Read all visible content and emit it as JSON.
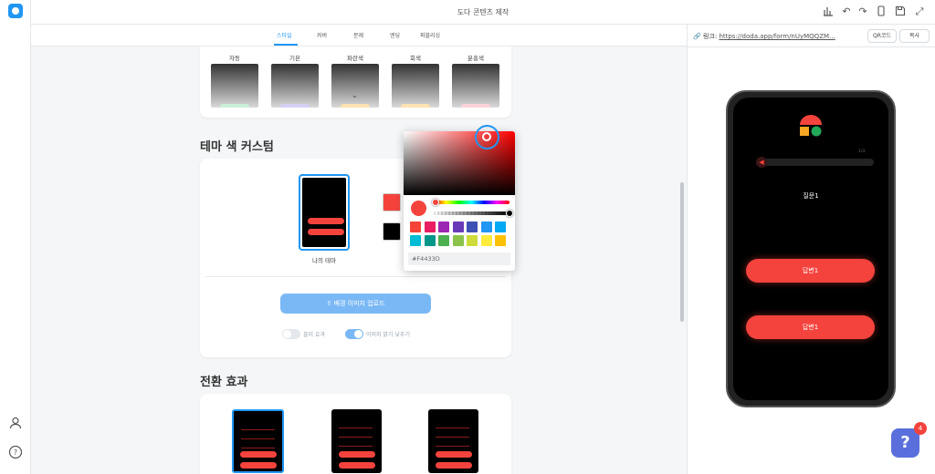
{
  "app": {
    "title": "도다 콘텐츠 제작"
  },
  "tabs": [
    {
      "label": "스타일",
      "active": true
    },
    {
      "label": "커버"
    },
    {
      "label": "문제"
    },
    {
      "label": "엔딩"
    },
    {
      "label": "퍼블리싱"
    }
  ],
  "style_presets": [
    {
      "label": "자동",
      "chip_color": "#c8f0d8"
    },
    {
      "label": "기본",
      "chip_color": "#d6d0f5"
    },
    {
      "label": "파란색",
      "chip_color": "#fde3b0"
    },
    {
      "label": "회색",
      "chip_color": "#fde3b0"
    },
    {
      "label": "분홍색",
      "chip_color": "#fbd3d8"
    }
  ],
  "theme_custom": {
    "title": "테마 색 커스텀",
    "my_theme_label": "나의 테마",
    "primary_color": "#f4433d",
    "background_color": "#000000",
    "upload_label": "배경 이미지 업로드",
    "toggles": [
      {
        "label": "블러 효과",
        "on": false
      },
      {
        "label": "이미지 밝기 낮추기",
        "on": true
      }
    ]
  },
  "color_picker": {
    "hex_value": "#F4433D",
    "swatches": [
      "#f44336",
      "#e91e63",
      "#9c27b0",
      "#673ab7",
      "#3f51b5",
      "#2196f3",
      "#03a9f4",
      "#00bcd4",
      "#009688",
      "#4caf50",
      "#8bc34a",
      "#cddc39",
      "#ffeb3b",
      "#ffc107"
    ]
  },
  "transition": {
    "title": "전환 효과"
  },
  "preview": {
    "link_label": "링크:",
    "link_url": "https://doda.app/form/nUyMQQZM...",
    "qr_label": "QR코드",
    "copy_label": "복사",
    "progress_count": "1/3",
    "question": "질문1",
    "answers": [
      "답변1",
      "답변1"
    ]
  },
  "help": {
    "badge_count": "4",
    "label": "?"
  },
  "colors": {
    "accent": "#2196f3",
    "theme_red": "#f4433d"
  }
}
